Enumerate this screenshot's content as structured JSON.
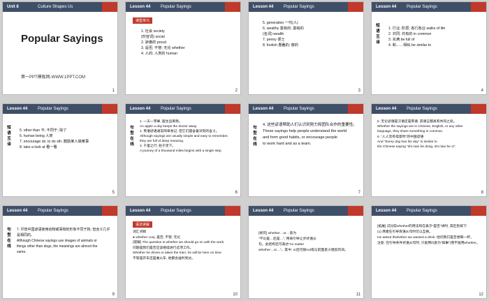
{
  "slides": [
    {
      "num": "1",
      "unit": "Unit 8",
      "topic": "Culture Shapes Us",
      "title": "Popular Sayings",
      "credit": "第一PPT模板网-WWW.1PPT.COM"
    },
    {
      "num": "2",
      "lesson": "Lesson 44",
      "topic": "Popular Sayings",
      "tag": "课堂单元",
      "lines": [
        "1. 社会 society",
        "(形容词) social",
        "2. 骄傲的 proud",
        "3. 是否; 不管; 无论 whether",
        "4. 人的; 人类的 human"
      ]
    },
    {
      "num": "3",
      "lesson": "Lesson 44",
      "topic": "Popular Sayings",
      "lines": [
        "5. generation 一代(人)",
        "6. wealthy 富有的; 富裕的",
        "(名词) wealth",
        "7. penny 便士",
        "8. foolish 愚蠢的; 傻的"
      ]
    },
    {
      "num": "4",
      "lesson": "Lesson 44",
      "topic": "Popular Sayings",
      "side": "短语互译",
      "lines": [
        "1. 行业; 阶层; 各行各业 walks of life",
        "2. 共同; 共有的 in common",
        "3. 充满 be full of",
        "4. 和……相似 be similar to"
      ]
    },
    {
      "num": "5",
      "lesson": "Lesson 44",
      "topic": "Popular Sayings",
      "side": "短语互译",
      "lines": [
        "5. other than 不; 不同于; 除了",
        "6. human being 人类",
        "7. encourage sb. to do sth. 鼓励某人做某事",
        "8. take a look at 看一看"
      ]
    },
    {
      "num": "6",
      "lesson": "Lesson 44",
      "topic": "Popular Sayings",
      "side": "句型在线",
      "lines": [
        "1. 一天一苹果, 医生远离我。",
        "An apple a day keeps the doctor away.",
        "2. 英语谚语通常简单易记, 但它们蕴含着深刻的含义。",
        "Although sayings are usually simple and easy to remember,",
        "they are full of deep meaning.",
        "3. 千里之行, 始于足下。",
        "A journey of a thousand miles begins with a single step."
      ]
    },
    {
      "num": "7",
      "lesson": "Lesson 44",
      "topic": "Popular Sayings",
      "side": "句型在线",
      "lines": [
        "4. 这些谚语帮助人们认识到努力和团队合作的重要性。",
        "These sayings help people understand the world",
        "and form good habits, or encourage people",
        "to work hard and as a team."
      ]
    },
    {
      "num": "8",
      "lesson": "Lesson 44",
      "topic": "Popular Sayings",
      "lines": [
        "5. 无论谚语是汉语还是英语, 其语言都具有共同之处。",
        "Whether the sayings are in Chinese, English, or any other",
        "language, they share something in common.",
        "6. \"人人皆有得意时\"的中国谚语",
        "And \"Every dog has his day\" is similar to",
        "the Chinese saying \"shi nian he dong, shi nian he xi\"."
      ]
    },
    {
      "num": "9",
      "lesson": "Lesson 44",
      "topic": "Popular Sayings",
      "side": "句型在线",
      "lines": [
        "7. 尽管中国谚语使用动物或事物的形象不同于狗, 但含义几乎是相同的。",
        "Although Chinese sayings use images of animals or",
        "things other than dogs, the meanings are almost the",
        "same."
      ]
    },
    {
      "num": "10",
      "lesson": "Lesson 44",
      "topic": "Popular Sayings",
      "tag": "语法讲解",
      "lines": [
        "词汇点睛",
        "● whether conj. 是否; 不管; 无论",
        "[观察] The question is whether we should go on with the work.",
        "问题是我们是否应该继续进行这项工作。",
        "Whether he drives or takes the train, he will be here on time.",
        "不管是开车还是乘火车, 他都会准时到达。"
      ]
    },
    {
      "num": "11",
      "lesson": "Lesson 44",
      "topic": "Popular Sayings",
      "lines": [
        "[探究] whether…or…意为",
        "\"不论是…还是…\", 用来引导让步状语从",
        "句。此结构还可表达\"no matter",
        "whether…or…\"。其中, or后可接not或与前面意义相反的词。"
      ]
    },
    {
      "num": "12",
      "lesson": "Lesson 44",
      "topic": "Popular Sayings",
      "lines": [
        "[拓展] 试比较whether的用法和在表示\"是否\"讲时, 其区别如下:",
        "(1) 两者在引导宾语从句时可以互换。",
        "He asked if/whether we wanted a drink. 他问我们是否想喝一杯。",
        "注意: 在引导条件状语从句时, 只能用if(意为\"如果\")而不能用whether。"
      ]
    }
  ]
}
